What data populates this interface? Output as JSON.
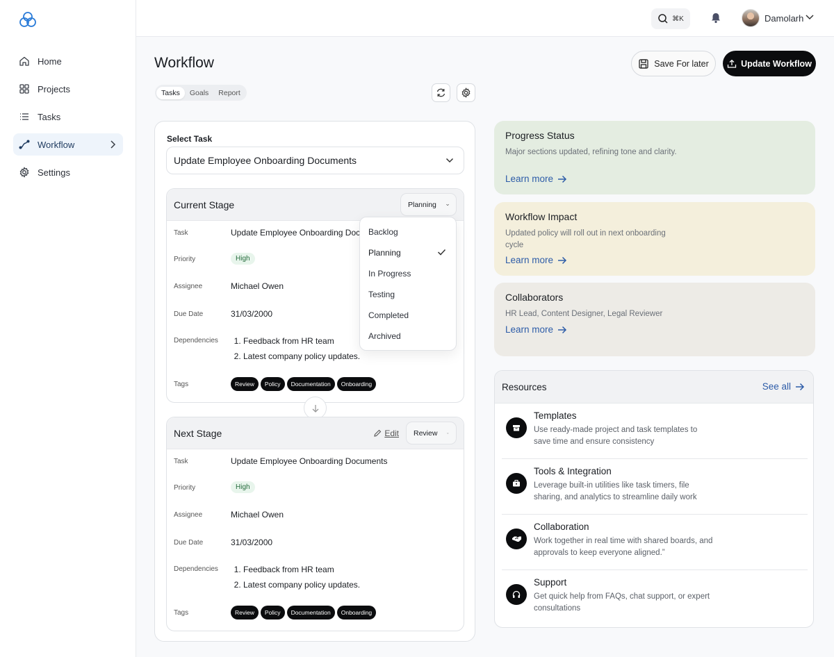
{
  "sidebar": {
    "items": [
      {
        "label": "Home",
        "icon": "home-icon"
      },
      {
        "label": "Projects",
        "icon": "grid-icon"
      },
      {
        "label": "Tasks",
        "icon": "list-icon"
      },
      {
        "label": "Workflow",
        "icon": "workflow-icon",
        "active": true
      },
      {
        "label": "Settings",
        "icon": "gear-icon"
      }
    ]
  },
  "topbar": {
    "search_shortcut": "⌘K",
    "username": "Damolarh"
  },
  "header": {
    "title": "Workflow",
    "save_later_label": "Save For later",
    "update_label": "Update Workflow",
    "tabs": [
      "Tasks",
      "Goals",
      "Report"
    ]
  },
  "task_panel": {
    "select_label": "Select Task",
    "selected_task": "Update Employee Onboarding Documents",
    "current_stage": {
      "title": "Current Stage",
      "stage_value": "Planning",
      "fields": {
        "task_label": "Task",
        "task_value": "Update Employee Onboarding Documents",
        "priority_label": "Priority",
        "priority_value": "High",
        "assignee_label": "Assignee",
        "assignee_value": "Michael Owen",
        "due_label": "Due Date",
        "due_value": "31/03/2000",
        "deps_label": "Dependencies",
        "deps": [
          "Feedback from HR team",
          "Latest company policy updates."
        ],
        "tags_label": "Tags",
        "tags": [
          "Review",
          "Policy",
          "Documentation",
          "Onboarding"
        ]
      }
    },
    "next_stage": {
      "title": "Next Stage",
      "edit_label": "Edit",
      "stage_value": "Review",
      "fields": {
        "task_label": "Task",
        "task_value": "Update Employee Onboarding Documents",
        "priority_label": "Priority",
        "priority_value": "High",
        "assignee_label": "Assignee",
        "assignee_value": "Michael Owen",
        "due_label": "Due Date",
        "due_value": "31/03/2000",
        "deps_label": "Dependencies",
        "deps": [
          "Feedback from HR team",
          "Latest company policy updates."
        ],
        "tags_label": "Tags",
        "tags": [
          "Review",
          "Policy",
          "Documentation",
          "Onboarding"
        ]
      }
    },
    "stage_menu": {
      "options": [
        "Backlog",
        "Planning",
        "In Progress",
        "Testing",
        "Completed",
        "Archived"
      ],
      "selected": "Planning"
    }
  },
  "cards": [
    {
      "title": "Progress Status",
      "text": "Major sections updated, refining tone and clarity.",
      "link": "Learn more",
      "color": "#e4ede1"
    },
    {
      "title": "Workflow Impact",
      "text": "Updated policy will roll out in next onboarding cycle",
      "link": "Learn more",
      "color": "#f4efdc"
    },
    {
      "title": "Collaborators",
      "text": "HR Lead, Content Designer, Legal Reviewer",
      "link": "Learn more",
      "color": "#edebe6"
    }
  ],
  "resources": {
    "title": "Resources",
    "see_all": "See all",
    "items": [
      {
        "title": "Templates",
        "desc": "Use ready-made project and task templates to save time and ensure consistency",
        "icon": "box-icon"
      },
      {
        "title": "Tools & Integration",
        "desc": "Leverage built-in utilities like task timers, file sharing, and analytics to streamline daily work",
        "icon": "briefcase-icon"
      },
      {
        "title": "Collaboration",
        "desc": "Work together in real time with shared boards, and approvals to keep everyone aligned.”",
        "icon": "handshake-icon"
      },
      {
        "title": "Support",
        "desc": "Get quick help from FAQs, chat support, or expert consultations",
        "icon": "headphones-icon"
      }
    ]
  }
}
